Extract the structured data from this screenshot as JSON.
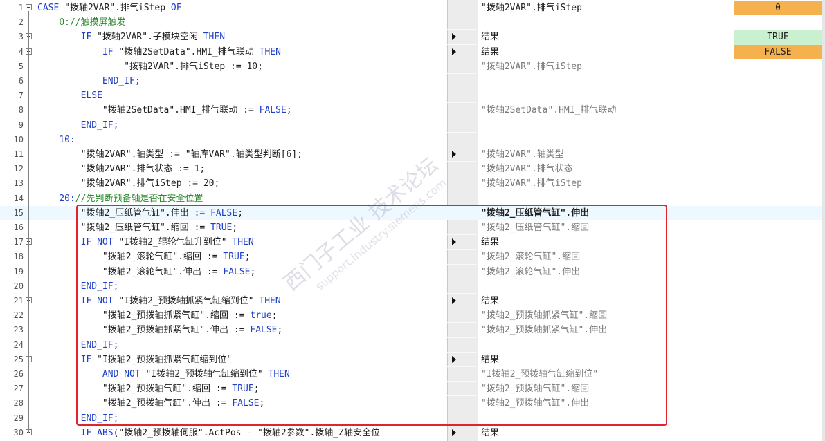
{
  "editor": {
    "lines": [
      {
        "n": "1",
        "fold": true,
        "parts": [
          [
            "kw",
            "CASE "
          ],
          [
            "st",
            "\"拨轴2VAR\".排气iStep "
          ],
          [
            "kw",
            "OF"
          ]
        ],
        "mon": "\"拨轴2VAR\".排气iStep",
        "mon_style": "active",
        "arrow": false,
        "value": "0",
        "value_color": "orange"
      },
      {
        "n": "2",
        "fold": false,
        "parts": [
          [
            "st",
            "    "
          ],
          [
            "cm",
            "0://触摸屏触发"
          ]
        ],
        "mon": "",
        "mon_style": "active",
        "arrow": false,
        "value": "",
        "value_color": ""
      },
      {
        "n": "3",
        "fold": true,
        "parts": [
          [
            "st",
            "        "
          ],
          [
            "kw",
            "IF "
          ],
          [
            "st",
            "\"拨轴2VAR\".子模块空闲 "
          ],
          [
            "kw",
            "THEN"
          ]
        ],
        "mon": "结果",
        "mon_style": "active",
        "arrow": true,
        "value": "TRUE",
        "value_color": "green"
      },
      {
        "n": "4",
        "fold": true,
        "parts": [
          [
            "st",
            "            "
          ],
          [
            "kw",
            "IF "
          ],
          [
            "st",
            "\"拨轴2SetData\".HMI_排气联动 "
          ],
          [
            "kw",
            "THEN"
          ]
        ],
        "mon": "结果",
        "mon_style": "active",
        "arrow": true,
        "value": "FALSE",
        "value_color": "orange"
      },
      {
        "n": "5",
        "fold": false,
        "parts": [
          [
            "st",
            "                \"拨轴2VAR\".排气iStep := 10;"
          ]
        ],
        "mon": "\"拨轴2VAR\".排气iStep",
        "mon_style": "inactive",
        "arrow": false,
        "value": "",
        "value_color": ""
      },
      {
        "n": "6",
        "fold": false,
        "parts": [
          [
            "st",
            "            "
          ],
          [
            "kw",
            "END_IF;"
          ]
        ],
        "mon": "",
        "mon_style": "active",
        "arrow": false,
        "value": "",
        "value_color": ""
      },
      {
        "n": "7",
        "fold": false,
        "parts": [
          [
            "st",
            "        "
          ],
          [
            "kw",
            "ELSE"
          ]
        ],
        "mon": "",
        "mon_style": "active",
        "arrow": false,
        "value": "",
        "value_color": ""
      },
      {
        "n": "8",
        "fold": false,
        "parts": [
          [
            "st",
            "            \"拨轴2SetData\".HMI_排气联动 := "
          ],
          [
            "kw",
            "FALSE"
          ],
          [
            "st",
            ";"
          ]
        ],
        "mon": "\"拨轴2SetData\".HMI_排气联动",
        "mon_style": "inactive",
        "arrow": false,
        "value": "",
        "value_color": ""
      },
      {
        "n": "9",
        "fold": false,
        "parts": [
          [
            "st",
            "        "
          ],
          [
            "kw",
            "END_IF;"
          ]
        ],
        "mon": "",
        "mon_style": "active",
        "arrow": false,
        "value": "",
        "value_color": ""
      },
      {
        "n": "10",
        "fold": false,
        "parts": [
          [
            "st",
            "    "
          ],
          [
            "kw",
            "10:"
          ]
        ],
        "mon": "",
        "mon_style": "active",
        "arrow": false,
        "value": "",
        "value_color": ""
      },
      {
        "n": "11",
        "fold": false,
        "parts": [
          [
            "st",
            "        \"拨轴2VAR\".轴类型 := \"轴库VAR\".轴类型判断[6];"
          ]
        ],
        "mon": "\"拨轴2VAR\".轴类型",
        "mon_style": "inactive",
        "arrow": true,
        "value": "",
        "value_color": ""
      },
      {
        "n": "12",
        "fold": false,
        "parts": [
          [
            "st",
            "        \"拨轴2VAR\".排气状态 := 1;"
          ]
        ],
        "mon": "\"拨轴2VAR\".排气状态",
        "mon_style": "inactive",
        "arrow": false,
        "value": "",
        "value_color": ""
      },
      {
        "n": "13",
        "fold": false,
        "parts": [
          [
            "st",
            "        \"拨轴2VAR\".排气iStep := 20;"
          ]
        ],
        "mon": "\"拨轴2VAR\".排气iStep",
        "mon_style": "inactive",
        "arrow": false,
        "value": "",
        "value_color": ""
      },
      {
        "n": "14",
        "fold": false,
        "parts": [
          [
            "st",
            "    "
          ],
          [
            "kw",
            "20:"
          ],
          [
            "cm",
            "//先判断预备轴是否在安全位置"
          ]
        ],
        "mon": "",
        "mon_style": "active",
        "arrow": false,
        "value": "",
        "value_color": ""
      },
      {
        "n": "15",
        "fold": false,
        "parts": [
          [
            "st",
            "        \"拨轴2_压纸管气缸\".伸出 := "
          ],
          [
            "kw",
            "FALSE"
          ],
          [
            "st",
            ";"
          ]
        ],
        "mon": "\"拨轴2_压纸管气缸\".伸出",
        "mon_style": "bold",
        "arrow": false,
        "value": "",
        "value_color": "",
        "cursor": true
      },
      {
        "n": "16",
        "fold": false,
        "parts": [
          [
            "st",
            "        \"拨轴2_压纸管气缸\".缩回 := "
          ],
          [
            "kw",
            "TRUE"
          ],
          [
            "st",
            ";"
          ]
        ],
        "mon": "\"拨轴2_压纸管气缸\".缩回",
        "mon_style": "inactive",
        "arrow": false,
        "value": "",
        "value_color": ""
      },
      {
        "n": "17",
        "fold": true,
        "parts": [
          [
            "st",
            "        "
          ],
          [
            "kw",
            "IF NOT "
          ],
          [
            "st",
            "\"I拨轴2_辊轮气缸升到位\" "
          ],
          [
            "kw",
            "THEN"
          ]
        ],
        "mon": "结果",
        "mon_style": "active",
        "arrow": true,
        "value": "",
        "value_color": ""
      },
      {
        "n": "18",
        "fold": false,
        "parts": [
          [
            "st",
            "            \"拨轴2_滚轮气缸\".缩回 := "
          ],
          [
            "kw",
            "TRUE"
          ],
          [
            "st",
            ";"
          ]
        ],
        "mon": "\"拨轴2_滚轮气缸\".缩回",
        "mon_style": "inactive",
        "arrow": false,
        "value": "",
        "value_color": ""
      },
      {
        "n": "19",
        "fold": false,
        "parts": [
          [
            "st",
            "            \"拨轴2_滚轮气缸\".伸出 := "
          ],
          [
            "kw",
            "FALSE"
          ],
          [
            "st",
            ";"
          ]
        ],
        "mon": "\"拨轴2_滚轮气缸\".伸出",
        "mon_style": "inactive",
        "arrow": false,
        "value": "",
        "value_color": ""
      },
      {
        "n": "20",
        "fold": false,
        "parts": [
          [
            "st",
            "        "
          ],
          [
            "kw",
            "END_IF;"
          ]
        ],
        "mon": "",
        "mon_style": "active",
        "arrow": false,
        "value": "",
        "value_color": ""
      },
      {
        "n": "21",
        "fold": true,
        "parts": [
          [
            "st",
            "        "
          ],
          [
            "kw",
            "IF NOT "
          ],
          [
            "st",
            "\"I拨轴2_预拨轴抓紧气缸缩到位\" "
          ],
          [
            "kw",
            "THEN"
          ]
        ],
        "mon": "结果",
        "mon_style": "active",
        "arrow": true,
        "value": "",
        "value_color": ""
      },
      {
        "n": "22",
        "fold": false,
        "parts": [
          [
            "st",
            "            \"拨轴2_预拨轴抓紧气缸\".缩回 := "
          ],
          [
            "kw",
            "true"
          ],
          [
            "st",
            ";"
          ]
        ],
        "mon": "\"拨轴2_预拨轴抓紧气缸\".缩回",
        "mon_style": "inactive",
        "arrow": false,
        "value": "",
        "value_color": ""
      },
      {
        "n": "23",
        "fold": false,
        "parts": [
          [
            "st",
            "            \"拨轴2_预拨轴抓紧气缸\".伸出 := "
          ],
          [
            "kw",
            "FALSE"
          ],
          [
            "st",
            ";"
          ]
        ],
        "mon": "\"拨轴2_预拨轴抓紧气缸\".伸出",
        "mon_style": "inactive",
        "arrow": false,
        "value": "",
        "value_color": ""
      },
      {
        "n": "24",
        "fold": false,
        "parts": [
          [
            "st",
            "        "
          ],
          [
            "kw",
            "END_IF;"
          ]
        ],
        "mon": "",
        "mon_style": "active",
        "arrow": false,
        "value": "",
        "value_color": ""
      },
      {
        "n": "25",
        "fold": true,
        "parts": [
          [
            "st",
            "        "
          ],
          [
            "kw",
            "IF "
          ],
          [
            "st",
            "\"I拨轴2_预拨轴抓紧气缸缩到位\""
          ]
        ],
        "mon": "结果",
        "mon_style": "active",
        "arrow": true,
        "value": "",
        "value_color": ""
      },
      {
        "n": "26",
        "fold": false,
        "parts": [
          [
            "st",
            "            "
          ],
          [
            "kw",
            "AND NOT "
          ],
          [
            "st",
            "\"I拨轴2_预拨轴气缸缩到位\" "
          ],
          [
            "kw",
            "THEN"
          ]
        ],
        "mon": "\"I拨轴2_预拨轴气缸缩到位\"",
        "mon_style": "inactive",
        "arrow": false,
        "value": "",
        "value_color": ""
      },
      {
        "n": "27",
        "fold": false,
        "parts": [
          [
            "st",
            "            \"拨轴2_预拨轴气缸\".缩回 := "
          ],
          [
            "kw",
            "TRUE"
          ],
          [
            "st",
            ";"
          ]
        ],
        "mon": "\"拨轴2_预拨轴气缸\".缩回",
        "mon_style": "inactive",
        "arrow": false,
        "value": "",
        "value_color": ""
      },
      {
        "n": "28",
        "fold": false,
        "parts": [
          [
            "st",
            "            \"拨轴2_预拨轴气缸\".伸出 := "
          ],
          [
            "kw",
            "FALSE"
          ],
          [
            "st",
            ";"
          ]
        ],
        "mon": "\"拨轴2_预拨轴气缸\".伸出",
        "mon_style": "inactive",
        "arrow": false,
        "value": "",
        "value_color": ""
      },
      {
        "n": "29",
        "fold": false,
        "parts": [
          [
            "st",
            "        "
          ],
          [
            "kw",
            "END_IF;"
          ]
        ],
        "mon": "",
        "mon_style": "active",
        "arrow": false,
        "value": "",
        "value_color": ""
      },
      {
        "n": "30",
        "fold": true,
        "parts": [
          [
            "st",
            "        "
          ],
          [
            "kw",
            "IF ABS"
          ],
          [
            "st",
            "(\"拨轴2_预拨轴伺服\".ActPos - \"拨轴2参数\".拨轴_Z轴安全位"
          ]
        ],
        "mon": "结果",
        "mon_style": "active",
        "arrow": true,
        "value": "",
        "value_color": ""
      }
    ]
  },
  "watermark": {
    "text": "西门子工业 技术论坛",
    "url": "support.industry.siemens.com"
  },
  "colors": {
    "orange": "#f5b14d",
    "green": "#c9f0cf",
    "highlight": "#e0242b"
  }
}
